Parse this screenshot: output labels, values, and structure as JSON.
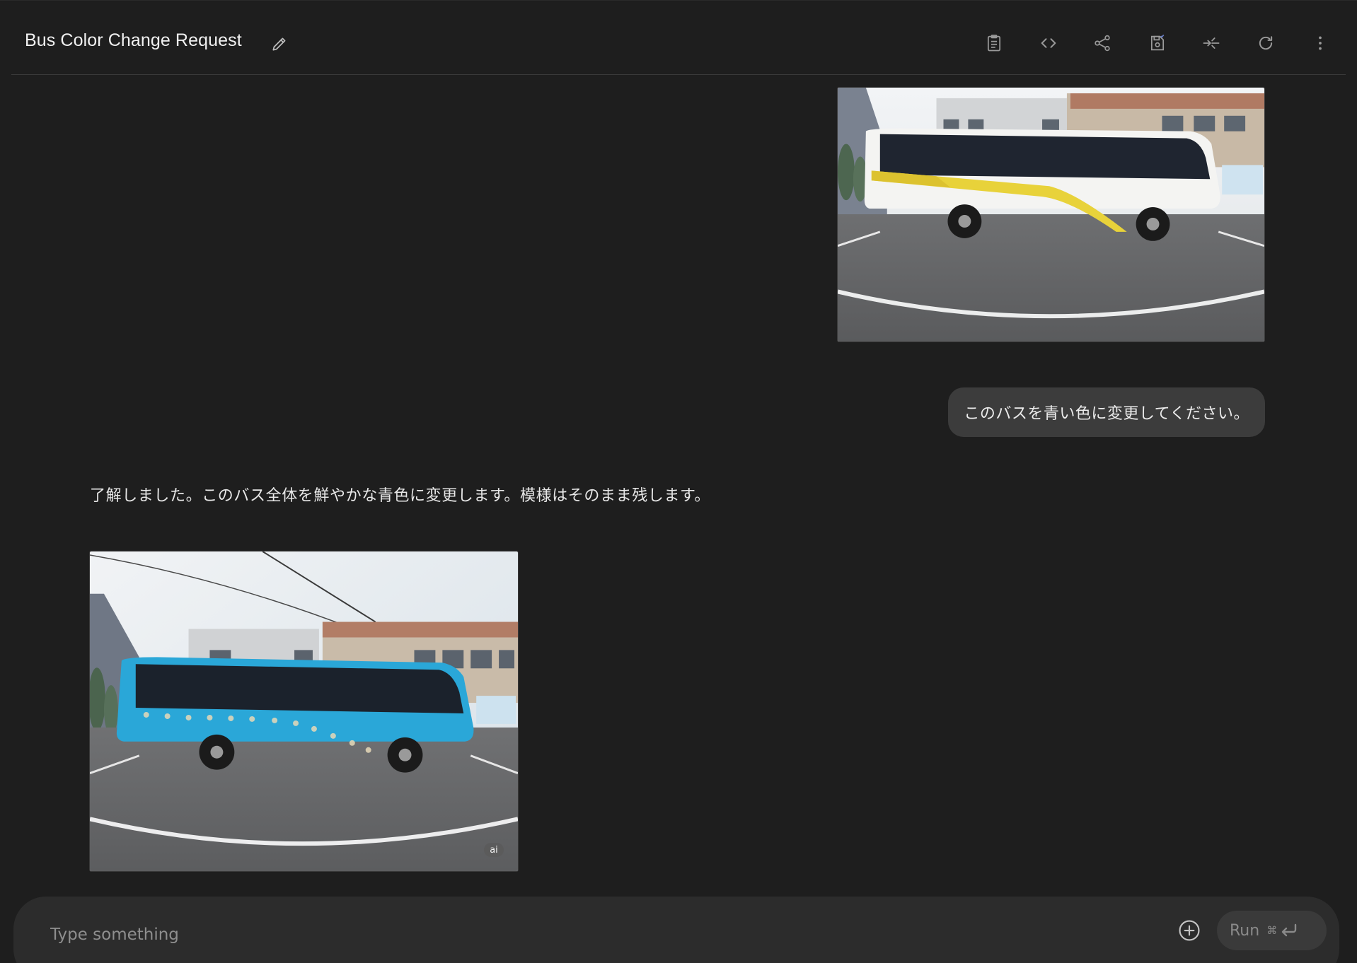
{
  "header": {
    "title": "Bus Color Change Request",
    "toolbar": [
      {
        "name": "clipboard-icon"
      },
      {
        "name": "code-icon"
      },
      {
        "name": "share-icon"
      },
      {
        "name": "save-icon"
      },
      {
        "name": "compare-icon"
      },
      {
        "name": "refresh-icon"
      },
      {
        "name": "more-vert-icon"
      }
    ]
  },
  "conversation": {
    "user_message": "このバスを青い色に変更してください。",
    "model_message": "了解しました。このバス全体を鮮やかな青色に変更します。模様はそのまま残します。",
    "ai_badge": "ai"
  },
  "composer": {
    "placeholder": "Type something",
    "run_label": "Run",
    "shortcut_symbol": "⌘"
  },
  "colors": {
    "background": "#1e1e1e",
    "bubble": "#3c3c3c",
    "composer": "#2c2c2c",
    "bus_original_stripe": "#e8d23a",
    "bus_edited": "#2aa7d8"
  }
}
